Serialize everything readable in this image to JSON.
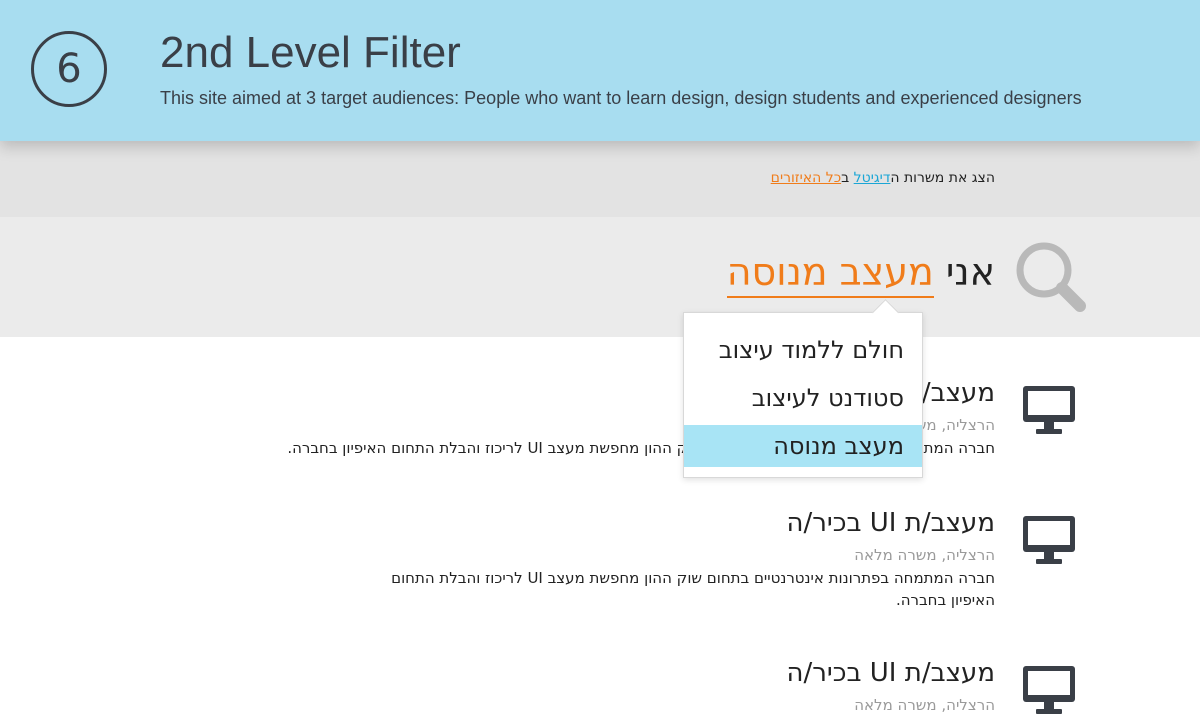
{
  "header": {
    "step_number": "6",
    "title": "2nd Level Filter",
    "subtitle": "This site aimed at 3 target audiences: People who want to learn design, design students and experienced designers"
  },
  "filter": {
    "prefix": "הצג את משרות ה",
    "category": "דיגיטל",
    "connector": " ב",
    "region": "כל האיזורים"
  },
  "search": {
    "prefix": "אני ",
    "level": "מעצב מנוסה"
  },
  "dropdown": {
    "options": [
      "חולם ללמוד עיצוב",
      "סטודנט לעיצוב",
      "מעצב מנוסה"
    ],
    "selected_index": 2
  },
  "jobs": [
    {
      "title": "מעצב/ת UI בכיר/ה",
      "meta": "הרצליה, משרה מלאה",
      "description": "חברה המתמחה בפתרונות אינטרנטיים בתחום שוק ההון מחפשת מעצב UI לריכוז והבלת התחום האיפיון בחברה."
    },
    {
      "title": "מעצב/ת UI בכיר/ה",
      "meta": "הרצליה, משרה מלאה",
      "description": "חברה המתמחה בפתרונות אינטרנטיים בתחום שוק ההון מחפשת מעצב UI לריכוז והבלת התחום האיפיון בחברה."
    },
    {
      "title": "מעצב/ת UI בכיר/ה",
      "meta": "הרצליה, משרה מלאה",
      "description": ""
    }
  ],
  "colors": {
    "header_bg": "#a8ddf0",
    "accent_orange": "#f07c1a",
    "link_blue": "#1aa6d6",
    "selected_option_bg": "#a8e4f5"
  },
  "icons": {
    "search": "magnifier-icon",
    "job": "monitor-icon"
  }
}
